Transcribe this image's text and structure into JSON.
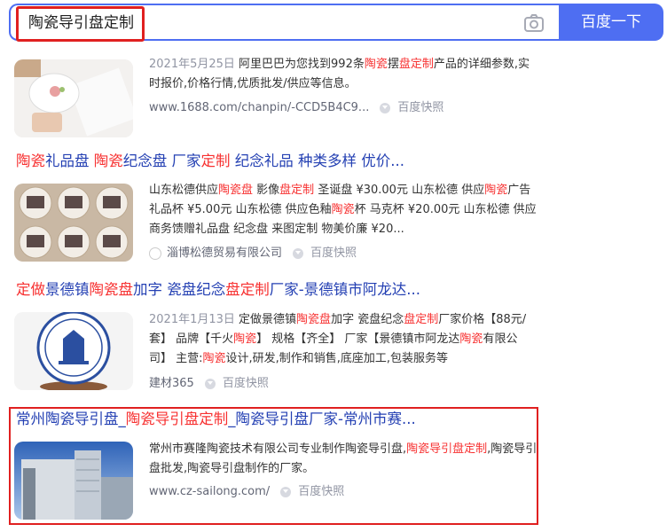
{
  "search": {
    "query": "陶瓷导引盘定制",
    "button_label": "百度一下"
  },
  "results": [
    {
      "title": [],
      "abstract": [
        {
          "text": "2021年5月25日 ",
          "style": "date"
        },
        {
          "text": "阿里巴巴为您找到992条"
        },
        {
          "text": "陶瓷",
          "style": "red"
        },
        {
          "text": "摆"
        },
        {
          "text": "盘定制",
          "style": "red"
        },
        {
          "text": "产品的详细参数,实时报价,价格行情,优质批发/供应等信息。"
        }
      ],
      "source": "www.1688.com/chanpin/-CCD5B4C9...",
      "snapshot": "百度快照"
    },
    {
      "title": [
        {
          "text": "陶瓷",
          "style": "red"
        },
        {
          "text": "礼品盘 "
        },
        {
          "text": "陶瓷",
          "style": "red"
        },
        {
          "text": "纪念盘 厂家"
        },
        {
          "text": "定制",
          "style": "red"
        },
        {
          "text": " 纪念礼品 种类多样 优价..."
        }
      ],
      "abstract": [
        {
          "text": "山东松德供应"
        },
        {
          "text": "陶瓷盘",
          "style": "red"
        },
        {
          "text": " 影像"
        },
        {
          "text": "盘定制",
          "style": "red"
        },
        {
          "text": " 圣诞盘 ¥30.00元 山东松德 供应"
        },
        {
          "text": "陶瓷",
          "style": "red"
        },
        {
          "text": "广告礼品杯 ¥5.00元 山东松德 供应色釉"
        },
        {
          "text": "陶瓷",
          "style": "red"
        },
        {
          "text": "杯 马克杯 ¥20.00元 山东松德 供应 商务馈赠礼品盘 纪念盘 来图定制 物美价廉 ¥20..."
        }
      ],
      "source": "淄博松德贸易有限公司",
      "snapshot": "百度快照"
    },
    {
      "title": [
        {
          "text": "定做",
          "style": "red"
        },
        {
          "text": "景德镇"
        },
        {
          "text": "陶瓷盘",
          "style": "red"
        },
        {
          "text": "加字 瓷盘纪念"
        },
        {
          "text": "盘定制",
          "style": "red"
        },
        {
          "text": "厂家-景德镇市阿龙达..."
        }
      ],
      "abstract": [
        {
          "text": "2021年1月13日 ",
          "style": "date"
        },
        {
          "text": "定做景德镇"
        },
        {
          "text": "陶瓷盘",
          "style": "red"
        },
        {
          "text": "加字 瓷盘纪念"
        },
        {
          "text": "盘定制",
          "style": "red"
        },
        {
          "text": "厂家价格【88元/套】 品牌【千火"
        },
        {
          "text": "陶瓷",
          "style": "red"
        },
        {
          "text": "】 规格【齐全】 厂家【景德镇市阿龙达"
        },
        {
          "text": "陶瓷",
          "style": "red"
        },
        {
          "text": "有限公司】 主营:"
        },
        {
          "text": "陶瓷",
          "style": "red"
        },
        {
          "text": "设计,研发,制作和销售,底座加工,包装服务等"
        }
      ],
      "source": "建材365",
      "snapshot": "百度快照"
    },
    {
      "title": [
        {
          "text": "常州陶瓷导引盘_"
        },
        {
          "text": "陶瓷导引盘定制",
          "style": "red"
        },
        {
          "text": "_陶瓷导引盘厂家-常州市赛..."
        }
      ],
      "abstract": [
        {
          "text": "常州市赛隆陶瓷技术有限公司专业制作陶瓷导引盘,"
        },
        {
          "text": "陶瓷导引盘定制",
          "style": "red"
        },
        {
          "text": ",陶瓷导引盘批发,陶瓷导引盘制作的厂家。"
        }
      ],
      "source": "www.cz-sailong.com/",
      "snapshot": "百度快照"
    }
  ],
  "colors": {
    "accent": "#4e6ef2",
    "title_link": "#2440b3",
    "highlight_red": "#f73131",
    "annotation_box": "#e02020"
  }
}
